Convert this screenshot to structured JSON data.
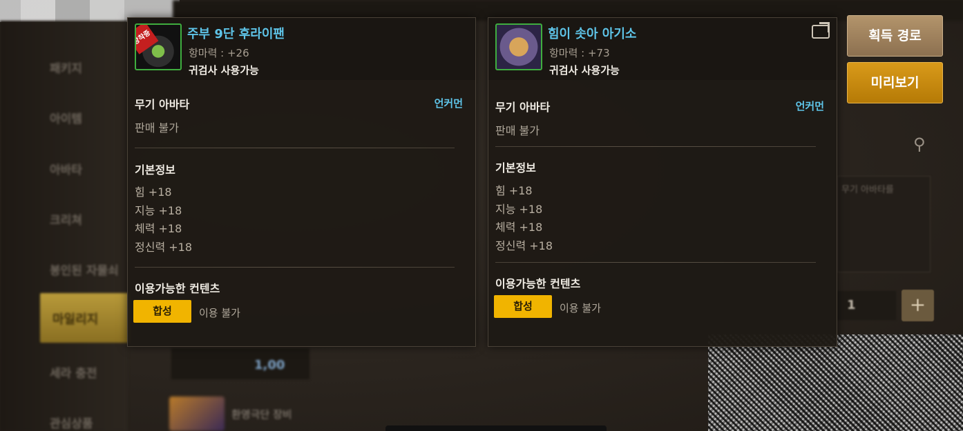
{
  "background": {
    "sidebar": [
      "패키지",
      "아이템",
      "아바타",
      "크리쳐",
      "봉인된 자물쇠"
    ],
    "mileage_label": "마일리지",
    "sidebar_extra": [
      "세라 충전",
      "관심상품"
    ],
    "strip_value": "1,00",
    "item_text": "환영극단 장비",
    "panel_text": "무기 아바타를",
    "qty": "1"
  },
  "left_item": {
    "badge": "장착중",
    "name": "주부 9단 후라이팬",
    "power": "항마력 : +26",
    "class_req": "귀검사 사용가능",
    "category": "무기 아바타",
    "rarity": "언커먼",
    "trade": "판매 불가",
    "basic_info_title": "기본정보",
    "stats": [
      "힘 +18",
      "지능 +18",
      "체력 +18",
      "정신력 +18"
    ],
    "contents_title": "이용가능한 컨텐츠",
    "synth_label": "합성",
    "synth_status": "이용 불가"
  },
  "right_item": {
    "name": "힘이 솟아 아기소",
    "power": "항마력 : +73",
    "class_req": "귀검사 사용가능",
    "category": "무기 아바타",
    "rarity": "언커먼",
    "trade": "판매 불가",
    "basic_info_title": "기본정보",
    "stats": [
      "힘 +18",
      "지능 +18",
      "체력 +18",
      "정신력 +18"
    ],
    "contents_title": "이용가능한 컨텐츠",
    "synth_label": "합성",
    "synth_status": "이용 불가"
  },
  "actions": {
    "route_label": "획득 경로",
    "preview_label": "미리보기"
  },
  "colors": {
    "item_name": "#5ec4e8",
    "rarity": "#5ec4e8",
    "synth_button": "#f1b400",
    "preview_button": "#d99a1a",
    "route_button": "#b3946b",
    "icon_border": "#3fae3f"
  }
}
